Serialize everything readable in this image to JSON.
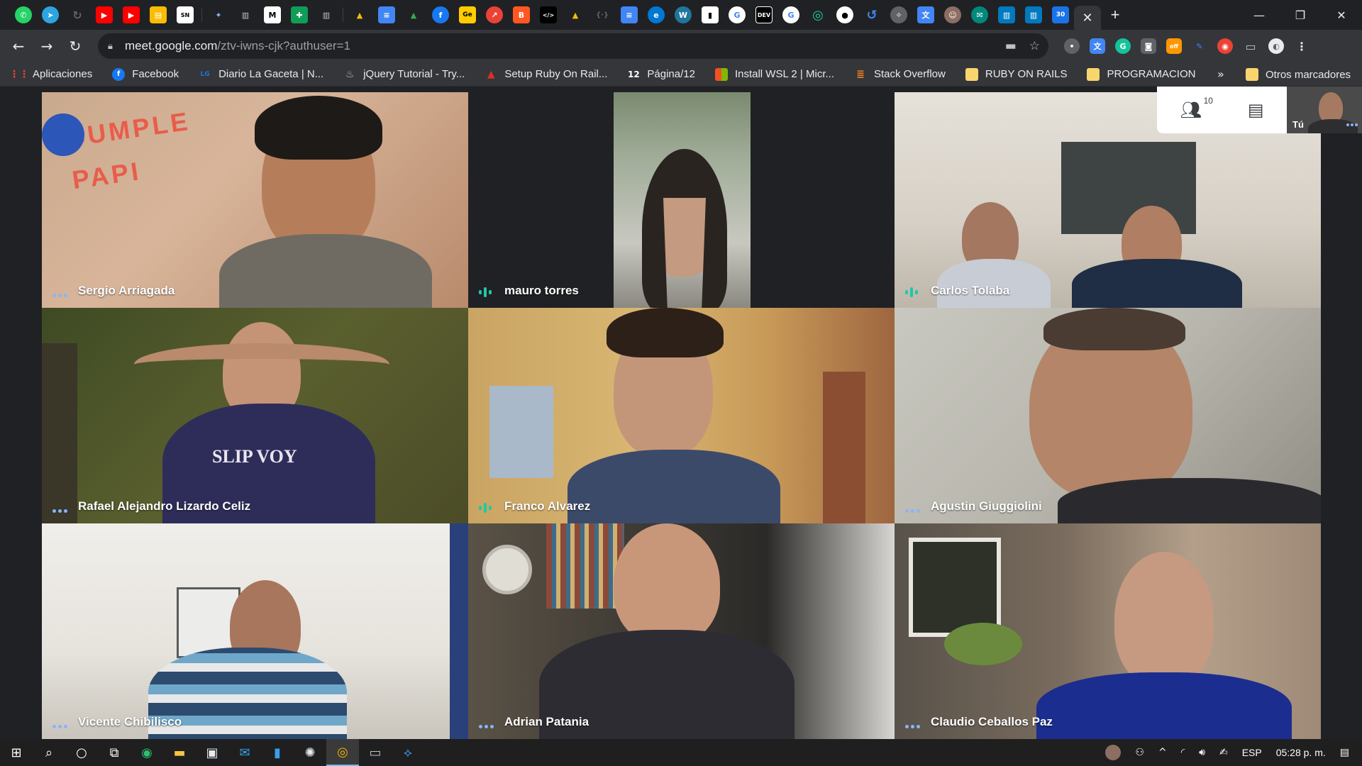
{
  "browser": {
    "tab_close": "✕",
    "new_tab": "+",
    "window_controls": {
      "minimize": "—",
      "restore": "❐",
      "close": "✕"
    },
    "url_host": "meet.google.com",
    "url_path": "/ztv-iwns-cjk?authuser=1"
  },
  "bookmarks": {
    "items": [
      {
        "label": "Aplicaciones",
        "icon": "apps-grid-icon",
        "color": "#ea4335"
      },
      {
        "label": "Facebook",
        "icon": "facebook-icon",
        "color": "#1877f2"
      },
      {
        "label": "Diario La Gaceta | N...",
        "icon": "la-gaceta-icon",
        "color": "#1a73e8"
      },
      {
        "label": "jQuery Tutorial - Try...",
        "icon": "w3schools-icon",
        "color": "#5f6368"
      },
      {
        "label": "Setup Ruby On Rail...",
        "icon": "rails-icon",
        "color": "#d93025"
      },
      {
        "label": "Página/12",
        "icon": "pagina12-icon",
        "color": "#202124"
      },
      {
        "label": "Install WSL 2 | Micr...",
        "icon": "microsoft-icon",
        "color": "#f25022"
      },
      {
        "label": "Stack Overflow",
        "icon": "stackoverflow-icon",
        "color": "#f48024"
      },
      {
        "label": "RUBY ON RAILS",
        "icon": "folder-icon",
        "color": "#f9d56e"
      },
      {
        "label": "PROGRAMACION",
        "icon": "folder-icon",
        "color": "#f9d56e"
      }
    ],
    "more": "»",
    "other": "Otros marcadores"
  },
  "meet": {
    "participants_count": "10",
    "self_label": "Tú",
    "tiles": [
      {
        "name": "Sergio Arriagada",
        "indicator": "dots"
      },
      {
        "name": "mauro torres",
        "indicator": "bars"
      },
      {
        "name": "Carlos Tolaba",
        "indicator": "bars"
      },
      {
        "name": "Rafael Alejandro Lizardo Celiz",
        "indicator": "dots"
      },
      {
        "name": "Franco Alvarez",
        "indicator": "bars"
      },
      {
        "name": "Agustin Giuggiolini",
        "indicator": "dots"
      },
      {
        "name": "Vicente Chibilisco",
        "indicator": "dots"
      },
      {
        "name": "Adrian Patania",
        "indicator": "dots"
      },
      {
        "name": "Claudio Ceballos Paz",
        "indicator": "dots"
      }
    ],
    "banner_text": "CUMPLE PAPI"
  },
  "taskbar": {
    "language": "ESP",
    "time": "05:28 p. m."
  }
}
